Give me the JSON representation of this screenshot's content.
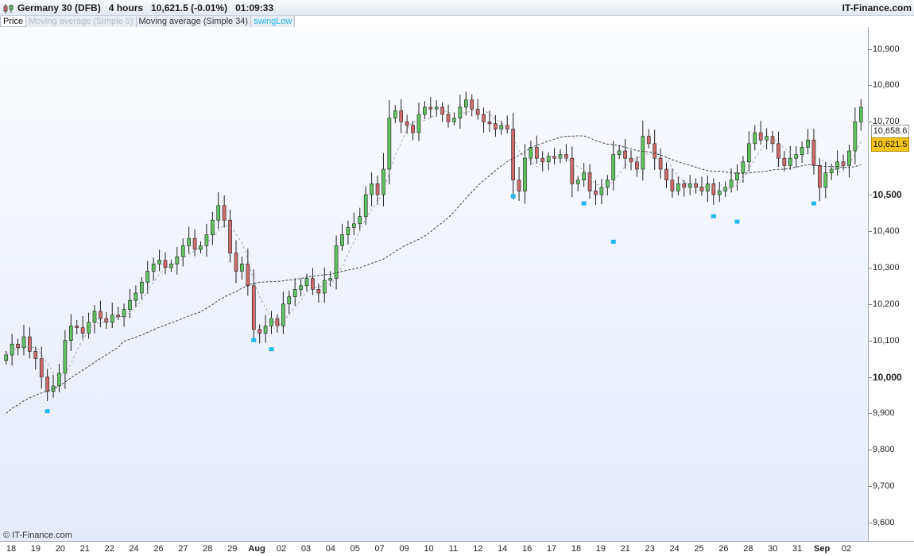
{
  "header": {
    "title": "Germany 30 (DFB)   4 hours   10,621.5 (-0.01%)   01:09:33",
    "brand": "IT-Finance.com",
    "icon": "chart-candles-icon"
  },
  "legend": {
    "price": "Price",
    "ma5": "Moving average (Simple 5)",
    "ma34": "Moving average (Simple 34)",
    "swing": "swingLow"
  },
  "price_tags": {
    "ma_value": "10,658.6",
    "last_price": "10,621.5"
  },
  "copyright": "© IT-Finance.com",
  "colors": {
    "up": "#5fc45f",
    "down": "#d06a6a",
    "wick": "#1e1e1e",
    "swing_marker": "#1eb8ee",
    "ma34": "#444444",
    "ma5": "#9a9a9a",
    "last_price_tag": "#f4c51b"
  },
  "chart_data": {
    "type": "candlestick",
    "instrument": "Germany 30 (DFB)",
    "timeframe": "4 hours",
    "last": 10621.5,
    "change_pct": -0.01,
    "ylim": [
      9550,
      10960
    ],
    "yticks": [
      {
        "v": 10900,
        "label": "10,900",
        "bold": false
      },
      {
        "v": 10800,
        "label": "10,800",
        "bold": false
      },
      {
        "v": 10700,
        "label": "10,700",
        "bold": false
      },
      {
        "v": 10500,
        "label": "10,500",
        "bold": true
      },
      {
        "v": 10400,
        "label": "10,400",
        "bold": false
      },
      {
        "v": 10300,
        "label": "10,300",
        "bold": false
      },
      {
        "v": 10200,
        "label": "10,200",
        "bold": false
      },
      {
        "v": 10100,
        "label": "10,100",
        "bold": false
      },
      {
        "v": 10000,
        "label": "10,000",
        "bold": true
      },
      {
        "v": 9900,
        "label": "9,900",
        "bold": false
      },
      {
        "v": 9800,
        "label": "9,800",
        "bold": false
      },
      {
        "v": 9700,
        "label": "9,700",
        "bold": false
      },
      {
        "v": 9600,
        "label": "9,600",
        "bold": false
      }
    ],
    "xticks": [
      {
        "label": "18",
        "bold": false
      },
      {
        "label": "19",
        "bold": false
      },
      {
        "label": "20",
        "bold": false
      },
      {
        "label": "21",
        "bold": false
      },
      {
        "label": "22",
        "bold": false
      },
      {
        "label": "24",
        "bold": false
      },
      {
        "label": "26",
        "bold": false
      },
      {
        "label": "27",
        "bold": false
      },
      {
        "label": "28",
        "bold": false
      },
      {
        "label": "29",
        "bold": false
      },
      {
        "label": "Aug",
        "bold": true
      },
      {
        "label": "02",
        "bold": false
      },
      {
        "label": "03",
        "bold": false
      },
      {
        "label": "04",
        "bold": false
      },
      {
        "label": "05",
        "bold": false
      },
      {
        "label": "07",
        "bold": false
      },
      {
        "label": "09",
        "bold": false
      },
      {
        "label": "10",
        "bold": false
      },
      {
        "label": "11",
        "bold": false
      },
      {
        "label": "12",
        "bold": false
      },
      {
        "label": "14",
        "bold": false
      },
      {
        "label": "16",
        "bold": false
      },
      {
        "label": "17",
        "bold": false
      },
      {
        "label": "18",
        "bold": false
      },
      {
        "label": "19",
        "bold": false
      },
      {
        "label": "21",
        "bold": false
      },
      {
        "label": "23",
        "bold": false
      },
      {
        "label": "24",
        "bold": false
      },
      {
        "label": "25",
        "bold": false
      },
      {
        "label": "26",
        "bold": false
      },
      {
        "label": "28",
        "bold": false
      },
      {
        "label": "30",
        "bold": false
      },
      {
        "label": "31",
        "bold": false
      },
      {
        "label": "Sep",
        "bold": true
      },
      {
        "label": "02",
        "bold": false
      }
    ],
    "closes": [
      10060,
      10090,
      10080,
      10110,
      10070,
      10050,
      10000,
      9960,
      9975,
      10010,
      10100,
      10140,
      10135,
      10120,
      10150,
      10180,
      10160,
      10150,
      10170,
      10165,
      10185,
      10210,
      10230,
      10260,
      10290,
      10310,
      10320,
      10300,
      10310,
      10330,
      10360,
      10380,
      10350,
      10360,
      10390,
      10430,
      10470,
      10430,
      10340,
      10290,
      10310,
      10250,
      10130,
      10120,
      10140,
      10160,
      10140,
      10200,
      10220,
      10240,
      10250,
      10270,
      10240,
      10230,
      10265,
      10270,
      10360,
      10390,
      10410,
      10420,
      10440,
      10500,
      10530,
      10500,
      10570,
      10710,
      10730,
      10700,
      10690,
      10670,
      10720,
      10740,
      10735,
      10740,
      10720,
      10700,
      10710,
      10740,
      10760,
      10735,
      10720,
      10700,
      10695,
      10680,
      10690,
      10680,
      10540,
      10510,
      10600,
      10630,
      10600,
      10590,
      10605,
      10600,
      10610,
      10600,
      10530,
      10540,
      10560,
      10510,
      10500,
      10520,
      10540,
      10610,
      10620,
      10600,
      10590,
      10570,
      10660,
      10640,
      10600,
      10570,
      10540,
      10510,
      10530,
      10520,
      10530,
      10520,
      10510,
      10530,
      10500,
      10510,
      10520,
      10540,
      10560,
      10590,
      10640,
      10670,
      10650,
      10660,
      10640,
      10600,
      10580,
      10600,
      10610,
      10630,
      10650,
      10580,
      10520,
      10560,
      10570,
      10590,
      10580,
      10620,
      10700,
      10740
    ],
    "swing_lows": [
      {
        "index": 7,
        "value": 9920
      },
      {
        "index": 42,
        "value": 10115
      },
      {
        "index": 45,
        "value": 10090
      },
      {
        "index": 86,
        "value": 10510
      },
      {
        "index": 98,
        "value": 10490
      },
      {
        "index": 103,
        "value": 10385
      },
      {
        "index": 120,
        "value": 10455
      },
      {
        "index": 124,
        "value": 10440
      },
      {
        "index": 137,
        "value": 10490
      }
    ]
  }
}
